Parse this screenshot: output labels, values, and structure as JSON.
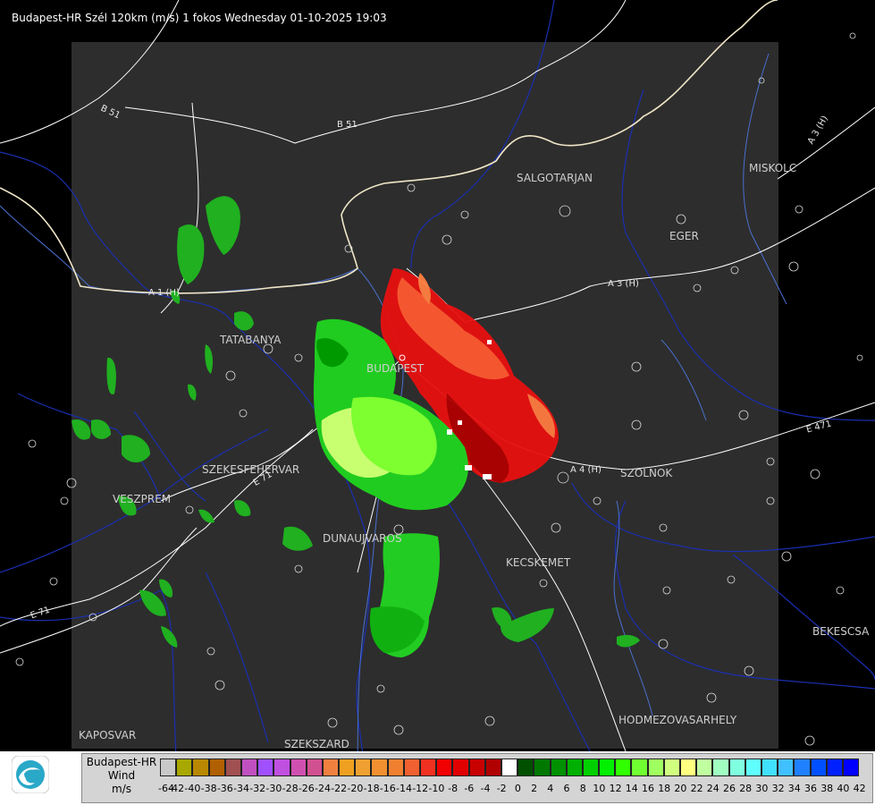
{
  "header": {
    "title": "Budapest-HR Szél 120km (m/s) 1 fokos Wednesday 01-10-2025 19:03"
  },
  "cities": [
    {
      "id": "salgotarjan",
      "label": "SALGOTARJAN"
    },
    {
      "id": "miskolc",
      "label": "MISKOLC"
    },
    {
      "id": "eger",
      "label": "EGER"
    },
    {
      "id": "tatabanya",
      "label": "TATABANYA"
    },
    {
      "id": "budapest",
      "label": "BUDAPEST"
    },
    {
      "id": "szolnok",
      "label": "SZOLNOK"
    },
    {
      "id": "szekesfehervar",
      "label": "SZEKESFEHERVAR"
    },
    {
      "id": "veszprem",
      "label": "VESZPREM"
    },
    {
      "id": "dunaujvaros",
      "label": "DUNAUJVAROS"
    },
    {
      "id": "kecskemet",
      "label": "KECSKEMET"
    },
    {
      "id": "bekescsaba",
      "label": "BEKESCSA"
    },
    {
      "id": "hodmezovasarhely",
      "label": "HODMEZOVASARHELY"
    },
    {
      "id": "kaposvar",
      "label": "KAPOSVAR"
    },
    {
      "id": "szekszard",
      "label": "SZEKSZARD"
    }
  ],
  "roads": [
    {
      "id": "b51-left",
      "label": "B 51"
    },
    {
      "id": "b51-mid",
      "label": "B 51"
    },
    {
      "id": "a3-right",
      "label": "A 3 (H)"
    },
    {
      "id": "a3-mid",
      "label": "A 3 (H)"
    },
    {
      "id": "a1",
      "label": "A 1 (H)"
    },
    {
      "id": "a4",
      "label": "A 4 (H)"
    },
    {
      "id": "e71",
      "label": "E 71"
    },
    {
      "id": "e71b",
      "label": "E 71"
    },
    {
      "id": "e471",
      "label": "E 471"
    }
  ],
  "legend": {
    "station": "Budapest-HR",
    "product": "Wind",
    "unit": "m/s",
    "ticks": [
      "-64",
      "-42",
      "-40",
      "-38",
      "-36",
      "-34",
      "-32",
      "-30",
      "-28",
      "-26",
      "-24",
      "-22",
      "-20",
      "-18",
      "-16",
      "-14",
      "-12",
      "-10",
      "-8",
      "-6",
      "-4",
      "-2",
      "0",
      "2",
      "4",
      "6",
      "8",
      "10",
      "12",
      "14",
      "16",
      "18",
      "20",
      "22",
      "24",
      "26",
      "28",
      "30",
      "32",
      "34",
      "36",
      "38",
      "40",
      "42"
    ],
    "colors": [
      "#c8c8c8",
      "#a8a800",
      "#b88800",
      "#b06000",
      "#a05050",
      "#c050c0",
      "#a050ff",
      "#c050e0",
      "#d050b0",
      "#d05090",
      "#f08040",
      "#f0a020",
      "#f0a030",
      "#f09030",
      "#f08030",
      "#f06030",
      "#f03020",
      "#f00000",
      "#e00000",
      "#c80000",
      "#b00000",
      "#ffffff",
      "#005000",
      "#007800",
      "#009000",
      "#00b000",
      "#00d000",
      "#00f000",
      "#30ff00",
      "#70ff30",
      "#a0ff60",
      "#d0ff80",
      "#ffff80",
      "#c0ffa0",
      "#a0ffc0",
      "#80ffe0",
      "#60ffff",
      "#40e0ff",
      "#40c0ff",
      "#2080ff",
      "#0050ff",
      "#0020ff",
      "#0000ff"
    ],
    "colors_note": ""
  }
}
